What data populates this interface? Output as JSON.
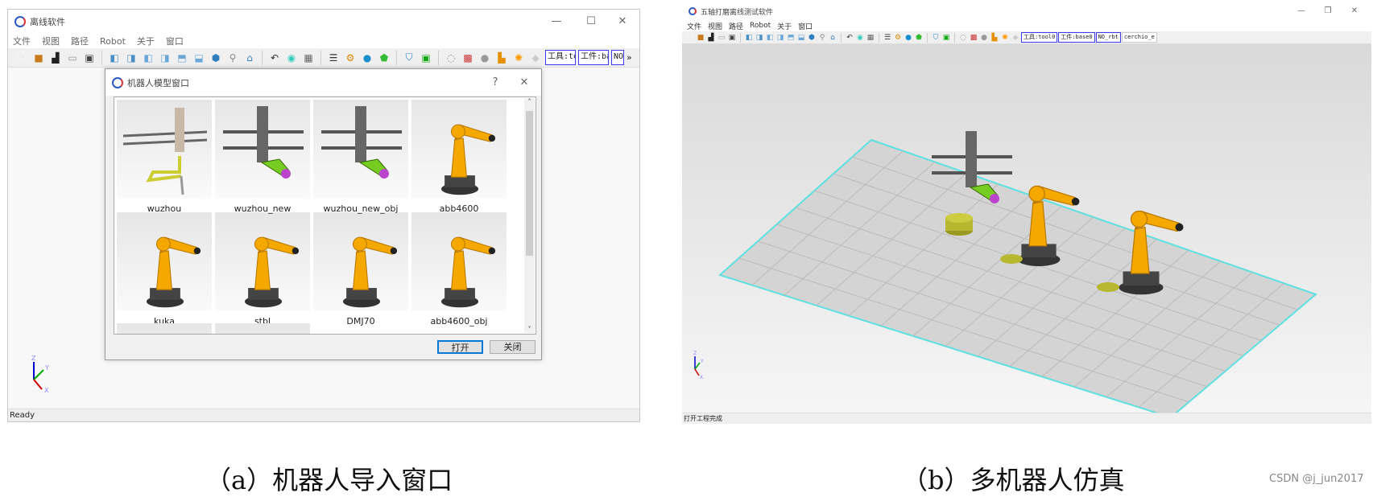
{
  "left_window": {
    "title": "离线软件",
    "controls": {
      "minimize": "—",
      "maximize": "☐",
      "close": "✕"
    },
    "menu": [
      "文件",
      "视图",
      "路径",
      "Robot",
      "关于",
      "窗口"
    ],
    "toolbar_icons": [
      "new-file",
      "open-box",
      "print",
      "open-folder",
      "save",
      "|",
      "view-front",
      "view-back",
      "view-left",
      "view-right",
      "view-top",
      "view-bottom",
      "view-iso",
      "zoom",
      "home",
      "|",
      "undo",
      "target",
      "frame",
      "|",
      "document",
      "robot-arm",
      "robot-face",
      "shield-green",
      "|",
      "shield-blue",
      "monitor",
      "|",
      "light",
      "palette",
      "sphere",
      "axis",
      "gear-orange",
      "diamond"
    ],
    "combos": [
      "工具:too",
      "工件:bas",
      "NO_"
    ],
    "overflow": "»",
    "status": "Ready",
    "axes": {
      "z": "Z",
      "y": "Y",
      "x": "X"
    }
  },
  "dialog": {
    "title": "机器人模型窗口",
    "help": "?",
    "close": "✕",
    "models": [
      {
        "name": "wuzhou",
        "kind": "gantry"
      },
      {
        "name": "wuzhou_new",
        "kind": "gantry2"
      },
      {
        "name": "wuzhou_new_obj",
        "kind": "gantry2"
      },
      {
        "name": "abb4600",
        "kind": "robot"
      },
      {
        "name": "kuka",
        "kind": "robot"
      },
      {
        "name": "stbl",
        "kind": "robot"
      },
      {
        "name": "DMJ70",
        "kind": "robot"
      },
      {
        "name": "abb4600_obj",
        "kind": "robot"
      }
    ],
    "open_button": "打开",
    "close_button": "关闭"
  },
  "right_window": {
    "title": "五轴打磨离线测试软件",
    "controls": {
      "minimize": "—",
      "maximize": "❐",
      "close": "✕"
    },
    "menu": [
      "文件",
      "视图",
      "路径",
      "Robot",
      "关于",
      "窗口"
    ],
    "combos": [
      "工具:tool0",
      "工件:base0",
      "NO_rbt",
      "cerchio_e"
    ],
    "status": "打开工程完成",
    "axes": {
      "z": "Z",
      "y": "Y",
      "x": "X"
    }
  },
  "captions": {
    "a": "（a）机器人导入窗口",
    "b": "（b）多机器人仿真"
  },
  "watermark": "CSDN @j_jun2017",
  "colors": {
    "robot": "#f5a800",
    "floor": "#d4d4d4",
    "floor_edge": "#5fe0e0",
    "combo_border": "#3a3af0"
  }
}
